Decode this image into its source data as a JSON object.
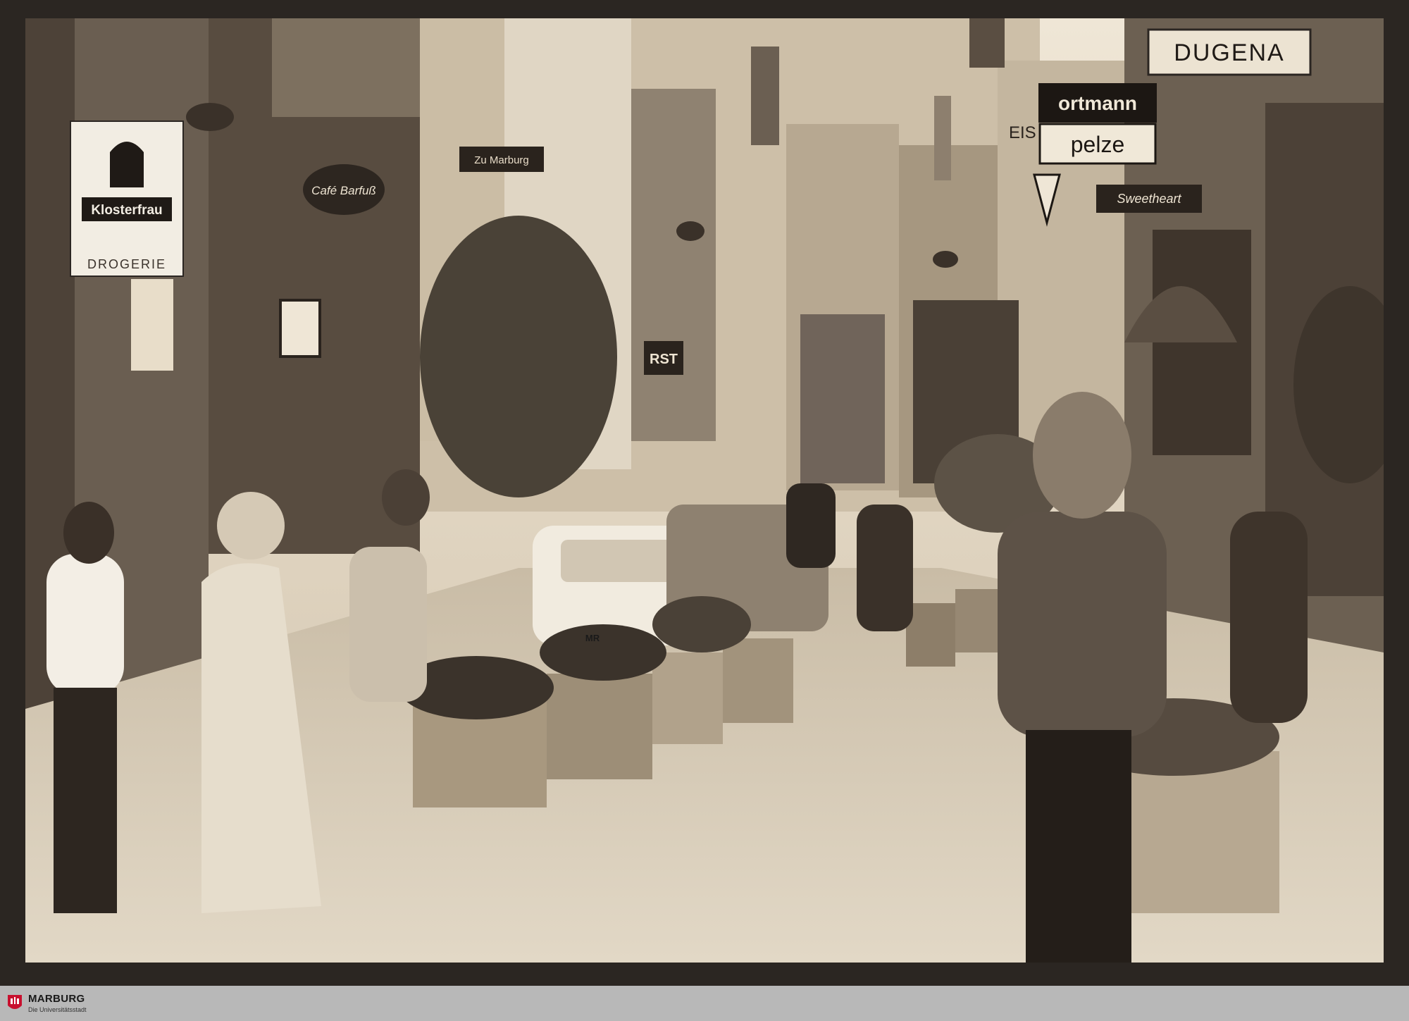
{
  "photo": {
    "description_hidden": false,
    "signs": {
      "klosterfrau": "Klosterfrau",
      "drogerie": "DROGERIE",
      "cafe": "Café Barfuß",
      "dugena": "DUGENA",
      "ortmann": "ortmann",
      "pelze": "pelze",
      "sweetheart": "Sweetheart",
      "zur_marburg": "Zu Marburg",
      "rst": "RST",
      "eis": "EIS",
      "mr": "MR"
    }
  },
  "footer": {
    "brand": "MARBURG",
    "tagline": "Die Universitätsstadt",
    "logo_color": "#c8102e"
  }
}
